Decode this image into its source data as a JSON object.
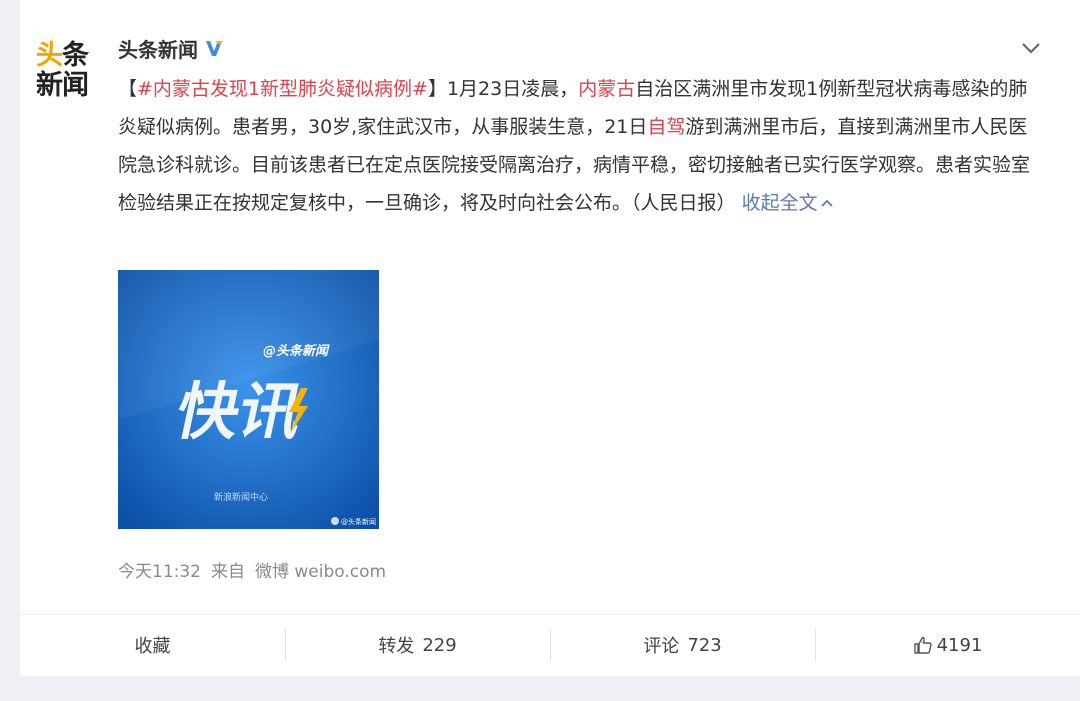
{
  "account": {
    "avatar_line1_a": "头",
    "avatar_line1_b": "条",
    "avatar_line2": "新闻",
    "name": "头条新闻"
  },
  "post": {
    "bracket_open": "【",
    "hashtag": "#内蒙古发现1新型肺炎疑似病例#",
    "bracket_close": "】",
    "seg1": "1月23日凌晨，",
    "hl1": "内蒙古",
    "seg2": "自治区满洲里市发现1例新型冠状病毒感染的肺炎疑似病例。患者男，30岁,家住武汉市，从事服装生意，21日",
    "hl2": "自驾",
    "seg3": "游到满洲里市后，直接到满洲里市人民医院急诊科就诊。目前该患者已在定点医院接受隔离治疗，病情平稳，密切接触者已实行医学观察。患者实验室检验结果正在按规定复核中，一旦确诊，将及时向社会公布。（人民日报）",
    "collapse_label": "收起全文"
  },
  "media": {
    "tag": "@头条新闻",
    "big_text": "快讯",
    "footer": "新浪新闻中心",
    "watermark": "@头条新闻"
  },
  "meta": {
    "time": "今天11:32",
    "from_label": "来自",
    "source": "微博 weibo.com"
  },
  "toolbar": {
    "favorite_label": "收藏",
    "repost_label": "转发",
    "repost_count": "229",
    "comment_label": "评论",
    "comment_count": "723",
    "like_count": "4191"
  },
  "colors": {
    "highlight": "#e2414b",
    "link": "#5b7bb0",
    "verified": "#3d8de0",
    "media_bg": "#1f6ec7",
    "bolt": "#f7b500"
  },
  "icons": [
    "verified-badge-icon",
    "chevron-down-icon",
    "thumbs-up-icon",
    "lightning-icon",
    "weibo-logo-icon"
  ]
}
